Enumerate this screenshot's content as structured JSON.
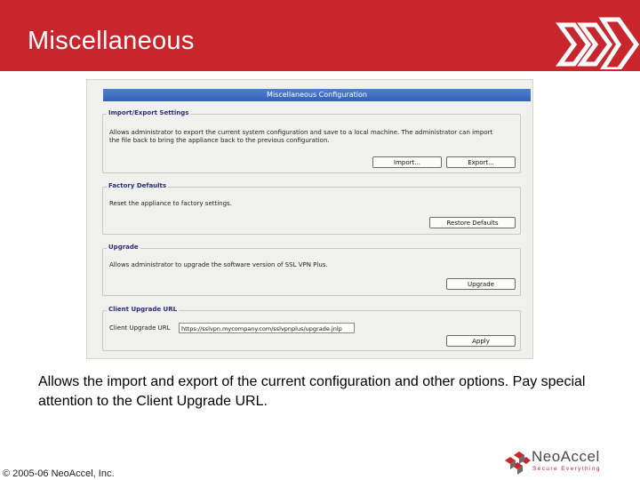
{
  "slide": {
    "title": "Miscellaneous",
    "caption": "Allows the import and export of the current configuration and other options. Pay special attention to the Client Upgrade URL.",
    "copyright": "© 2005-06 NeoAccel, Inc.",
    "colors": {
      "header": "#c8252c",
      "panel": "#f0f0ec",
      "title_bar": "#3461b8"
    }
  },
  "window": {
    "title": "Miscellaneous Configuration",
    "import_export": {
      "legend": "Import/Export Settings",
      "description_line1": "Allows administrator to export the current system configuration and save to a local machine. The administrator can import",
      "description_line2": "the file back to bring the appliance back to the previous configuration.",
      "import_label": "Import...",
      "export_label": "Export..."
    },
    "factory_defaults": {
      "legend": "Factory Defaults",
      "description": "Reset the appliance to factory settings.",
      "restore_label": "Restore Defaults"
    },
    "upgrade": {
      "legend": "Upgrade",
      "description": "Allows administrator to upgrade the software version of SSL VPN Plus.",
      "upgrade_label": "Upgrade"
    },
    "client_upgrade_url": {
      "legend": "Client Upgrade URL",
      "field_label": "Client Upgrade URL",
      "field_value": "https://sslvpn.mycompany.com/sslvpnplus/upgrade.jnlp",
      "apply_label": "Apply"
    }
  },
  "logo": {
    "name": "NeoAccel",
    "tagline": "Secure Everything"
  }
}
